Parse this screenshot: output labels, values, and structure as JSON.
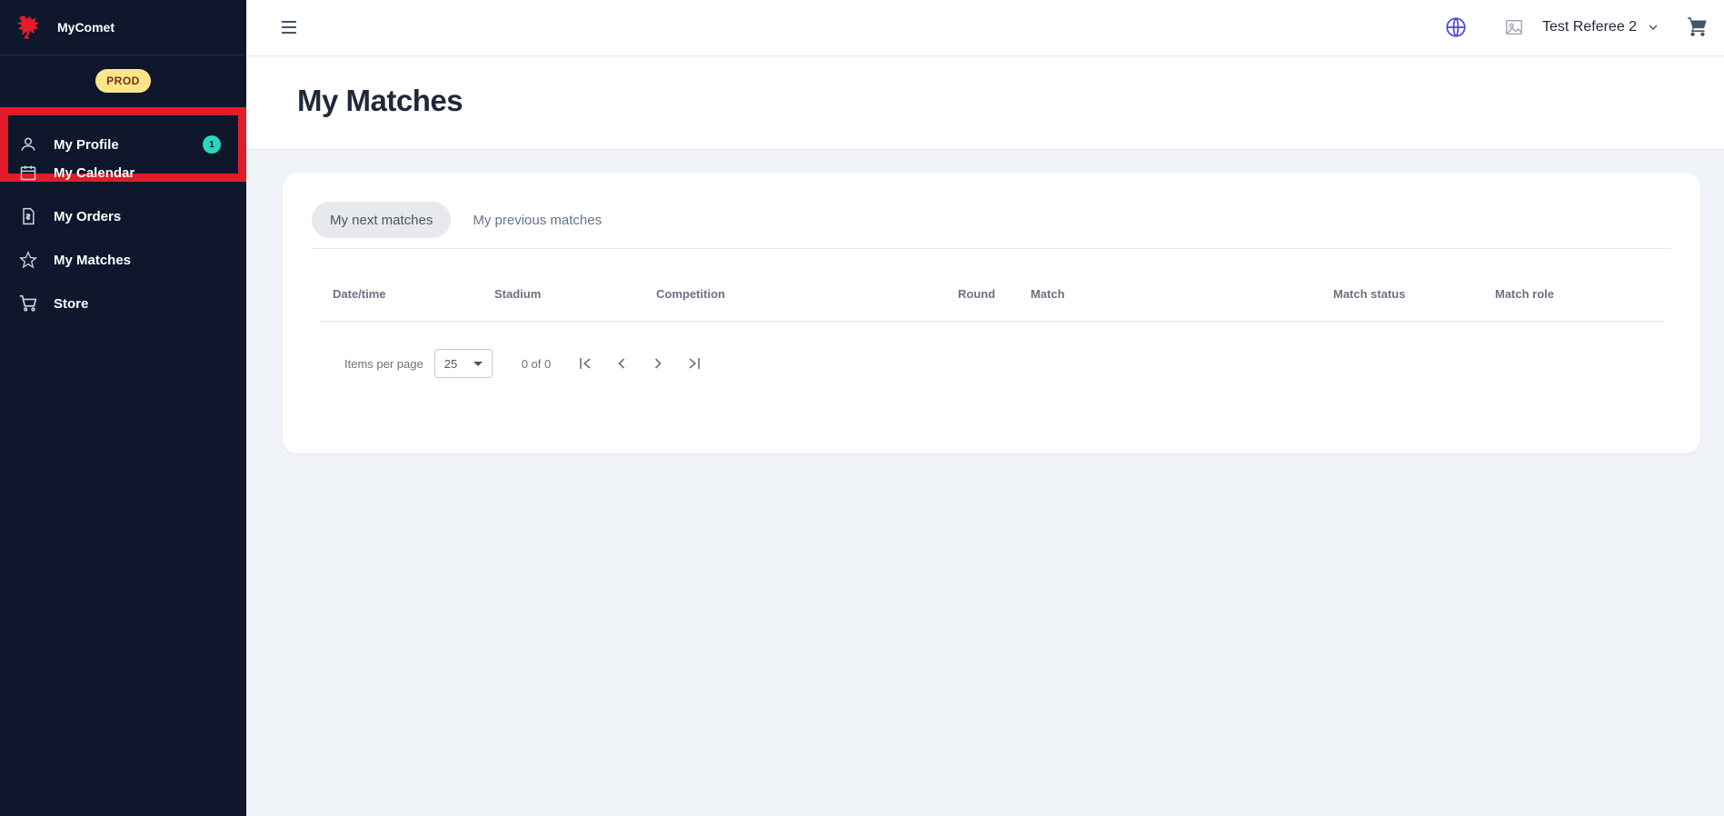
{
  "brand": {
    "name": "MyComet",
    "logo_icon": "dragon-logo-icon",
    "accent": "#e11d2a"
  },
  "environment": {
    "label": "PROD"
  },
  "sidebar": {
    "items": [
      {
        "label": "My Profile",
        "icon": "person-icon",
        "badge": "1",
        "active": true
      },
      {
        "label": "My Calendar",
        "icon": "calendar-icon"
      },
      {
        "label": "My Orders",
        "icon": "invoice-icon"
      },
      {
        "label": "My Matches",
        "icon": "star-icon"
      },
      {
        "label": "Store",
        "icon": "cart-icon"
      }
    ]
  },
  "topbar": {
    "menu_icon": "hamburger-icon",
    "language_icon": "globe-icon",
    "user": {
      "name": "Test Referee 2",
      "avatar_icon": "image-placeholder-icon",
      "chevron_icon": "chevron-down-icon"
    },
    "cart_icon": "shopping-cart-icon"
  },
  "page": {
    "title": "My Matches"
  },
  "tabs": [
    {
      "label": "My next matches",
      "active": true
    },
    {
      "label": "My previous matches",
      "active": false
    }
  ],
  "table": {
    "columns": [
      "Date/time",
      "Stadium",
      "Competition",
      "Round",
      "Match",
      "Match status",
      "Match role"
    ],
    "rows": []
  },
  "pagination": {
    "items_per_page_label": "Items per page",
    "items_per_page": "25",
    "range": "0 of 0"
  },
  "colors": {
    "sidebar_bg": "#0e172c",
    "badge": "#2dd4bf",
    "env_badge": "#fde68a",
    "globe": "#4f46e5",
    "page_bg": "#f0f3f7"
  }
}
